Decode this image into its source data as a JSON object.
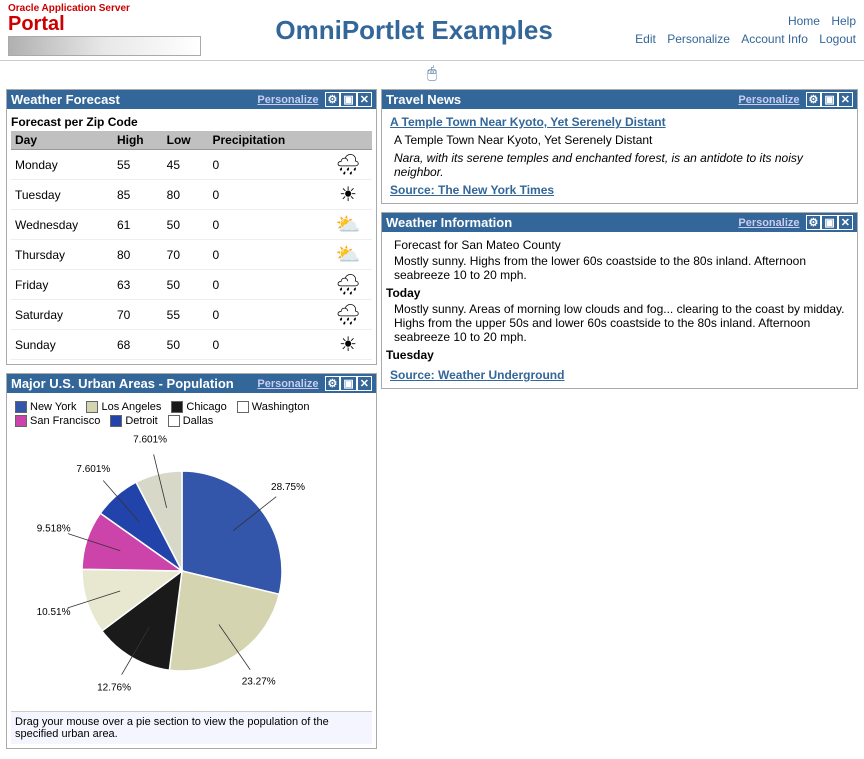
{
  "header": {
    "oracle_line1": "Oracle Application Server",
    "oracle_line2": "Portal",
    "app_title": "OmniPortlet Examples",
    "nav_top": {
      "home": "Home",
      "help": "Help"
    },
    "nav_bottom": {
      "edit": "Edit",
      "personalize": "Personalize",
      "account_info": "Account Info",
      "logout": "Logout"
    }
  },
  "arrow": "🖱",
  "weather_portlet": {
    "title": "Weather Forecast",
    "personalize": "Personalize",
    "zip_label": "Forecast per Zip Code",
    "columns": [
      "Day",
      "High",
      "Low",
      "Precipitation"
    ],
    "rows": [
      {
        "day": "Monday",
        "high": "55",
        "low": "45",
        "precip": "0",
        "icon": "🌧"
      },
      {
        "day": "Tuesday",
        "high": "85",
        "low": "80",
        "precip": "0",
        "icon": "☀"
      },
      {
        "day": "Wednesday",
        "high": "61",
        "low": "50",
        "precip": "0",
        "icon": "⛅"
      },
      {
        "day": "Thursday",
        "high": "80",
        "low": "70",
        "precip": "0",
        "icon": "⛅"
      },
      {
        "day": "Friday",
        "high": "63",
        "low": "50",
        "precip": "0",
        "icon": "🌧"
      },
      {
        "day": "Saturday",
        "high": "70",
        "low": "55",
        "precip": "0",
        "icon": "🌧"
      },
      {
        "day": "Sunday",
        "high": "68",
        "low": "50",
        "precip": "0",
        "icon": "☀"
      }
    ]
  },
  "travel_portlet": {
    "title": "Travel News",
    "personalize": "Personalize",
    "article_link": "A Temple Town Near Kyoto, Yet Serenely Distant",
    "article_title": "A Temple Town Near Kyoto, Yet Serenely Distant",
    "article_desc": "Nara, with its serene temples and enchanted forest, is an antidote to its noisy neighbor.",
    "source_label": "Source: The New York Times"
  },
  "weather_info_portlet": {
    "title": "Weather Information",
    "personalize": "Personalize",
    "location": "Forecast for San Mateo County",
    "days": [
      {
        "label": "",
        "text": "Mostly sunny. Highs from the lower 60s coastside to the 80s inland. Afternoon seabreeze 10 to 20 mph."
      },
      {
        "label": "Today",
        "text": "Mostly sunny. Areas of morning low clouds and fog... clearing to the coast by midday. Highs from the upper 50s and lower 60s coastside to the 80s inland. Afternoon seabreeze 10 to 20 mph."
      },
      {
        "label": "Tuesday",
        "text": ""
      }
    ],
    "source_label": "Source: Weather Underground"
  },
  "population_portlet": {
    "title": "Major U.S. Urban Areas - Population",
    "personalize": "Personalize",
    "legend": [
      {
        "label": "New York",
        "color": "#3355aa"
      },
      {
        "label": "Los Angeles",
        "color": "#d4d4b0"
      },
      {
        "label": "Chicago",
        "color": "#1a1a1a"
      },
      {
        "label": "Washington",
        "color": "#ffffff"
      },
      {
        "label": "San Francisco",
        "color": "#cc44aa"
      },
      {
        "label": "Detroit",
        "color": "#2244aa"
      },
      {
        "label": "Dallas",
        "color": "#ffffff"
      }
    ],
    "slices": [
      {
        "label": "New York",
        "value": 28.75,
        "color": "#3355aa"
      },
      {
        "label": "Los Angeles",
        "value": 23.27,
        "color": "#d4d4b0"
      },
      {
        "label": "Chicago",
        "value": 12.76,
        "color": "#1a1a1a"
      },
      {
        "label": "Washington",
        "value": 10.51,
        "color": "#e8e8d0"
      },
      {
        "label": "San Francisco",
        "value": 9.518,
        "color": "#cc44aa"
      },
      {
        "label": "Detroit",
        "value": 7.601,
        "color": "#2244aa"
      },
      {
        "label": "Dallas",
        "value": 7.601,
        "color": "#d8d8c8"
      }
    ],
    "labels": [
      {
        "percent": "28.75%",
        "angle": 60
      },
      {
        "percent": "23.27%",
        "angle": 168
      },
      {
        "percent": "12.76%",
        "angle": 246
      },
      {
        "percent": "10.51%",
        "angle": 282
      },
      {
        "percent": "9.518%",
        "angle": 314
      },
      {
        "percent": "7.601%",
        "angle": 338
      },
      {
        "percent": "7.601%",
        "angle": 356
      }
    ],
    "drag_note": "Drag your mouse over a pie section to view the population of the specified urban area."
  }
}
